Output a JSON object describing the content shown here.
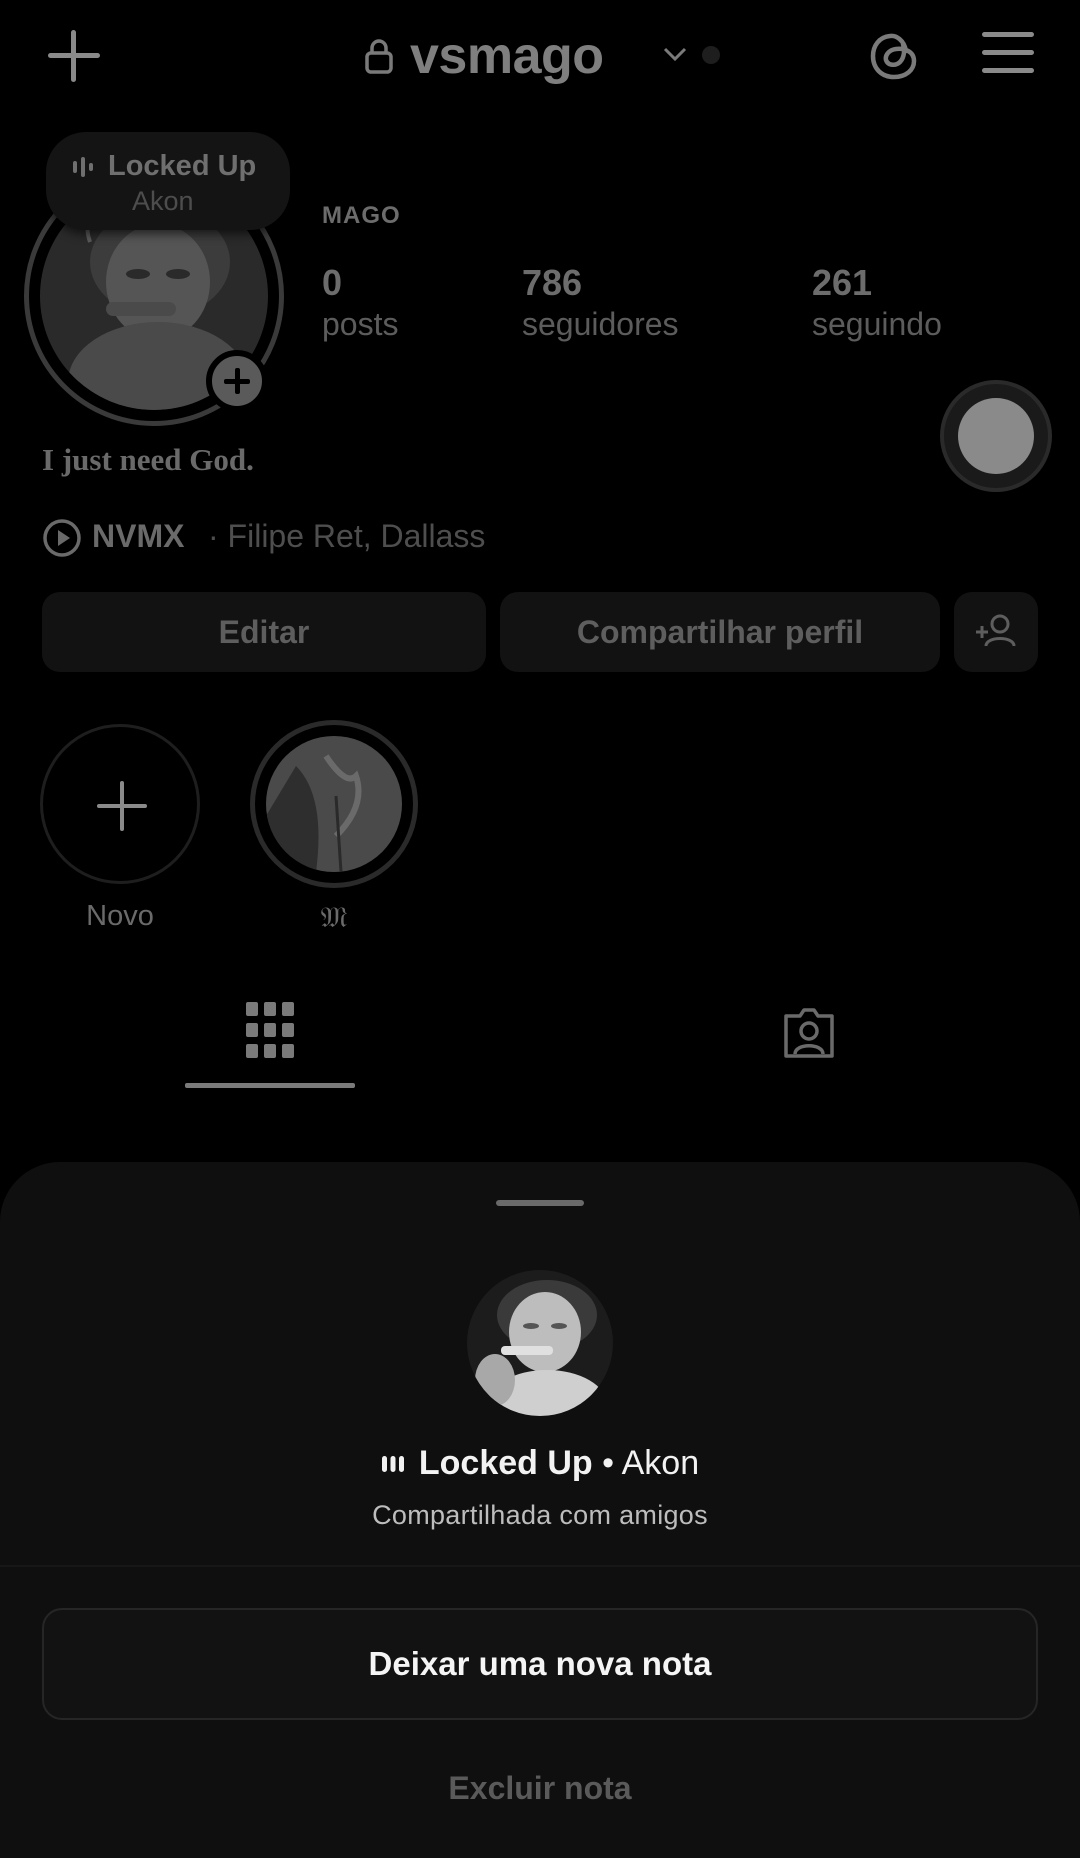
{
  "header": {
    "username": "vsmago"
  },
  "profile": {
    "display_name": "MAGO",
    "stats": [
      {
        "value": "0",
        "label": "posts"
      },
      {
        "value": "786",
        "label": "seguidores"
      },
      {
        "value": "261",
        "label": "seguindo"
      }
    ],
    "bio": "I just need God.",
    "music": {
      "song": "NVMX",
      "artists": "· Filipe Ret, Dallass"
    },
    "note_bubble": {
      "title": "Locked Up",
      "artist": "Akon"
    }
  },
  "actions": {
    "edit": "Editar",
    "share": "Compartilhar perfil"
  },
  "highlights": [
    {
      "label": "Novo"
    },
    {
      "label": "𝔐"
    }
  ],
  "sheet": {
    "song_title": "Locked Up",
    "song_sep_artist": " • Akon",
    "subtitle": "Compartilhada com amigos",
    "primary_button": "Deixar uma nova nota",
    "secondary_button": "Excluir nota"
  },
  "icons": {
    "top_left": "plus-icon",
    "lock": "lock-icon",
    "chevron": "chevron-down-icon",
    "threads": "threads-icon",
    "menu": "hamburger-menu-icon",
    "grid": "grid-icon",
    "tagged": "tagged-person-icon",
    "add_person": "add-person-icon"
  }
}
